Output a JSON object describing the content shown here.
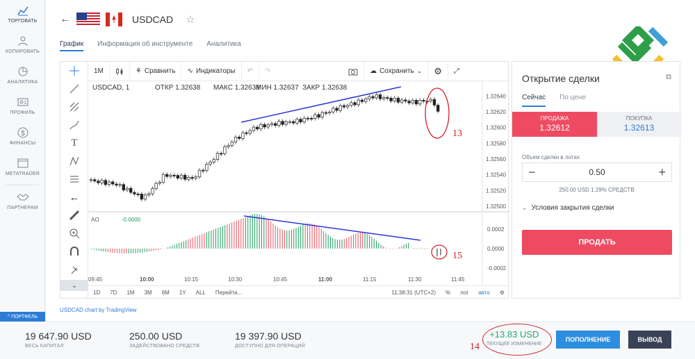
{
  "sidebar": {
    "items": [
      {
        "label": "ТОРГОВАТЬ",
        "icon": "chart-icon",
        "active": true
      },
      {
        "label": "КОПИРОВАТЬ",
        "icon": "copy-trade-icon"
      },
      {
        "label": "АНАЛИТИКА",
        "icon": "analytics-icon"
      },
      {
        "label": "ПРОФИЛЬ",
        "icon": "profile-icon"
      },
      {
        "label": "ФИНАНСЫ",
        "icon": "dollar-icon"
      },
      {
        "label": "METATRADER",
        "icon": "metatrader-icon"
      },
      {
        "label": "ПАРТНЕРАМ",
        "icon": "handshake-icon"
      }
    ],
    "portfolio": "^ ПОРТФЕЛЬ"
  },
  "header": {
    "symbol": "USDCAD"
  },
  "tabs": [
    "График",
    "Информация об инструменте",
    "Аналитика"
  ],
  "toolbar": {
    "interval": "1M",
    "compare": "Сравнить",
    "indicators": "Индикаторы",
    "save": "Сохранить"
  },
  "legend": {
    "symbol": "USDCAD, 1",
    "open": "ОТКР 1.32638",
    "high": "МАКС 1.32638",
    "low": "МИН 1.32637",
    "close": "ЗАКР 1.32638"
  },
  "ao": {
    "label": "AO",
    "value": "-0.0000"
  },
  "price_axis": [
    "1.32640",
    "1.32620",
    "1.32600",
    "1.32580",
    "1.32560",
    "1.32540",
    "1.32520",
    "1.32500"
  ],
  "ao_axis": [
    "0.0002",
    "0.0000",
    "-0.0002"
  ],
  "time_axis": [
    "09:45",
    "10:00",
    "10:15",
    "10:30",
    "10:45",
    "11:00",
    "11:15",
    "11:30",
    "11:45"
  ],
  "footer": {
    "ranges": [
      "1D",
      "7D",
      "1M",
      "3M",
      "6M",
      "1Y",
      "ALL"
    ],
    "goto": "Перейти...",
    "clock": "11:38:31 (UTC+2)",
    "pct": "%",
    "log": "лог",
    "auto": "авто"
  },
  "credit": "USDCAD chart by TradingView",
  "chart_data": {
    "type": "candlestick",
    "x": [
      "09:45",
      "10:00",
      "10:15",
      "10:30",
      "10:45",
      "11:00",
      "11:15",
      "11:30",
      "11:45"
    ],
    "ylim": [
      1.325,
      1.3265
    ],
    "last": 1.32638,
    "ao_ylim": [
      -0.0003,
      0.0003
    ]
  },
  "trade": {
    "title": "Открытие сделки",
    "tab_now": "Сейчас",
    "tab_price": "По цене",
    "sell_label": "ПРОДАЖА",
    "sell_price": "1.32612",
    "buy_label": "ПОКУПКА",
    "buy_price": "1.32613",
    "volume_label": "Объем сделки в лотах",
    "volume": "0.50",
    "minus": "−",
    "plus": "+",
    "volume_sub": "250.00 USD   1.29% СРЕДСТВ",
    "conditions": "Условия закрытия сделки",
    "sell_button": "ПРОДАТЬ"
  },
  "bottom": {
    "capital": "19 647.90 USD",
    "capital_label": "ВЕСЬ КАПИТАЛ",
    "used": "250.00 USD",
    "used_label": "ЗАДЕЙСТВОВАНО СРЕДСТВ",
    "available": "19 397.90 USD",
    "available_label": "ДОСТУПНО ДЛЯ ОПЕРАЦИЙ",
    "change": "+13.83 USD",
    "change_label": "ТЕКУЩЕЕ ИЗМЕНЕНИЕ",
    "deposit": "ПОПОЛНЕНИЕ",
    "withdraw": "ВЫВОД"
  },
  "annotations": [
    "13",
    "15",
    "14"
  ],
  "colors": {
    "accent": "#2d7bd6",
    "sell": "#ee4b62",
    "up": "#1b9e5a",
    "down": "#e8555f",
    "trend": "#2a34d8",
    "anno": "#d0202a"
  }
}
